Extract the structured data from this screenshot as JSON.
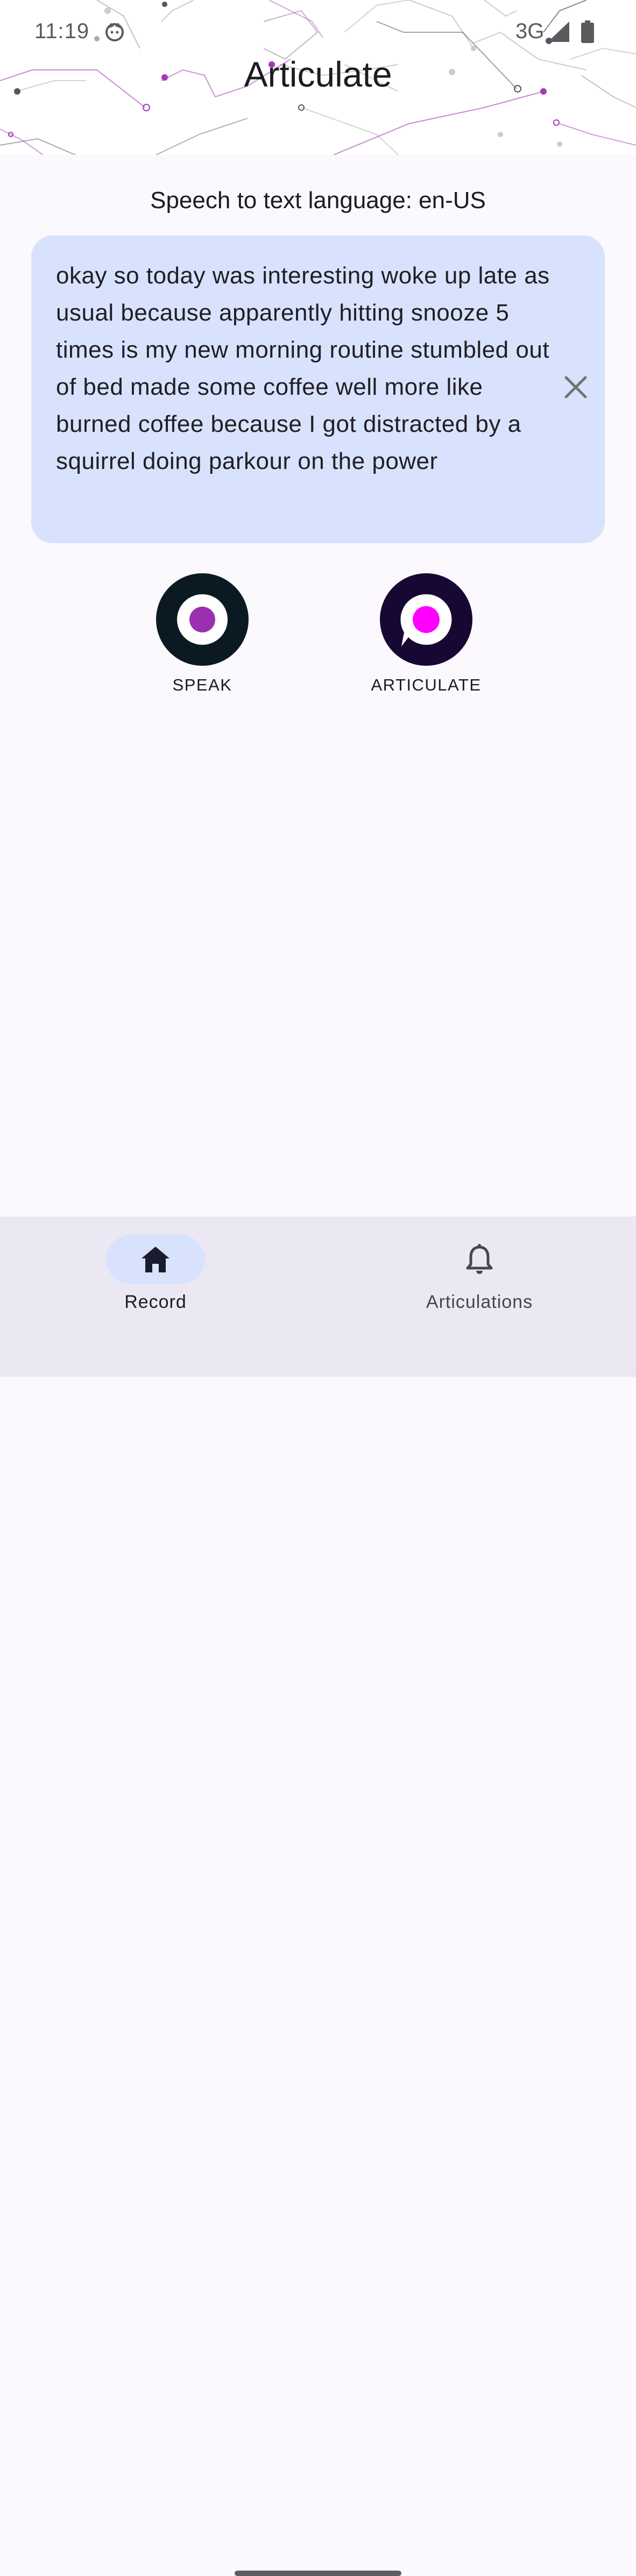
{
  "status_bar": {
    "time": "11:19",
    "network": "3G",
    "icons": [
      "cat-notification-icon",
      "cell-signal-icon",
      "battery-icon"
    ]
  },
  "header": {
    "title": "Articulate",
    "accent_color": "#a33bb5",
    "line_color": "#555560"
  },
  "main": {
    "language_label": "Speech to text language: en-US",
    "transcript": "okay so today was interesting woke up late as usual because apparently hitting snooze 5 times is my new morning routine stumbled out of bed made some coffee well more like burned coffee because I got distracted by a squirrel doing parkour on the power",
    "clear_icon": "close-icon",
    "card_color": "#d8e2fc"
  },
  "actions": {
    "speak": {
      "label": "SPEAK",
      "icon": "record-icon",
      "color": "#0b1a22",
      "dot_color": "#9c2eb0"
    },
    "articulate": {
      "label": "ARTICULATE",
      "icon": "speech-bubble-icon",
      "color": "#170833",
      "dot_color": "#ff00ff"
    }
  },
  "bottom_nav": {
    "items": [
      {
        "label": "Record",
        "icon": "home-icon",
        "selected": true
      },
      {
        "label": "Articulations",
        "icon": "bell-icon",
        "selected": false
      }
    ]
  }
}
